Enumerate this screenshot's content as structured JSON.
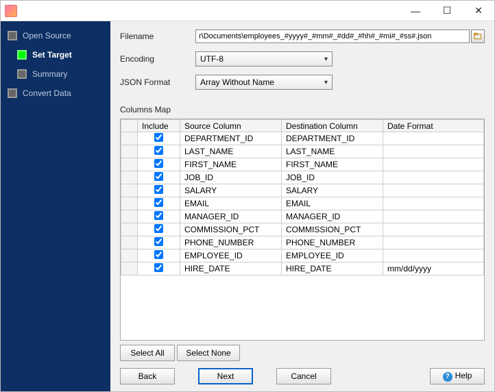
{
  "titlebar": {
    "min": "—",
    "max": "☐",
    "close": "✕"
  },
  "sidebar": {
    "steps": [
      {
        "label": "Open Source",
        "active": false,
        "sub": false
      },
      {
        "label": "Set Target",
        "active": true,
        "sub": true
      },
      {
        "label": "Summary",
        "active": false,
        "sub": true
      },
      {
        "label": "Convert Data",
        "active": false,
        "sub": false
      }
    ]
  },
  "form": {
    "filename_label": "Filename",
    "filename_value": "r\\Documents\\employees_#yyyy#_#mm#_#dd#_#hh#_#mi#_#ss#.json",
    "encoding_label": "Encoding",
    "encoding_value": "UTF-8",
    "json_format_label": "JSON Format",
    "json_format_value": "Array Without Name"
  },
  "columns_map": {
    "label": "Columns Map",
    "headers": {
      "include": "Include",
      "source": "Source Column",
      "dest": "Destination Column",
      "datefmt": "Date Format"
    },
    "rows": [
      {
        "include": true,
        "source": "DEPARTMENT_ID",
        "dest": "DEPARTMENT_ID",
        "datefmt": ""
      },
      {
        "include": true,
        "source": "LAST_NAME",
        "dest": "LAST_NAME",
        "datefmt": ""
      },
      {
        "include": true,
        "source": "FIRST_NAME",
        "dest": "FIRST_NAME",
        "datefmt": ""
      },
      {
        "include": true,
        "source": "JOB_ID",
        "dest": "JOB_ID",
        "datefmt": ""
      },
      {
        "include": true,
        "source": "SALARY",
        "dest": "SALARY",
        "datefmt": ""
      },
      {
        "include": true,
        "source": "EMAIL",
        "dest": "EMAIL",
        "datefmt": ""
      },
      {
        "include": true,
        "source": "MANAGER_ID",
        "dest": "MANAGER_ID",
        "datefmt": ""
      },
      {
        "include": true,
        "source": "COMMISSION_PCT",
        "dest": "COMMISSION_PCT",
        "datefmt": ""
      },
      {
        "include": true,
        "source": "PHONE_NUMBER",
        "dest": "PHONE_NUMBER",
        "datefmt": ""
      },
      {
        "include": true,
        "source": "EMPLOYEE_ID",
        "dest": "EMPLOYEE_ID",
        "datefmt": ""
      },
      {
        "include": true,
        "source": "HIRE_DATE",
        "dest": "HIRE_DATE",
        "datefmt": "mm/dd/yyyy"
      }
    ]
  },
  "buttons": {
    "select_all": "Select All",
    "select_none": "Select None",
    "back": "Back",
    "next": "Next",
    "cancel": "Cancel",
    "help": "Help"
  }
}
